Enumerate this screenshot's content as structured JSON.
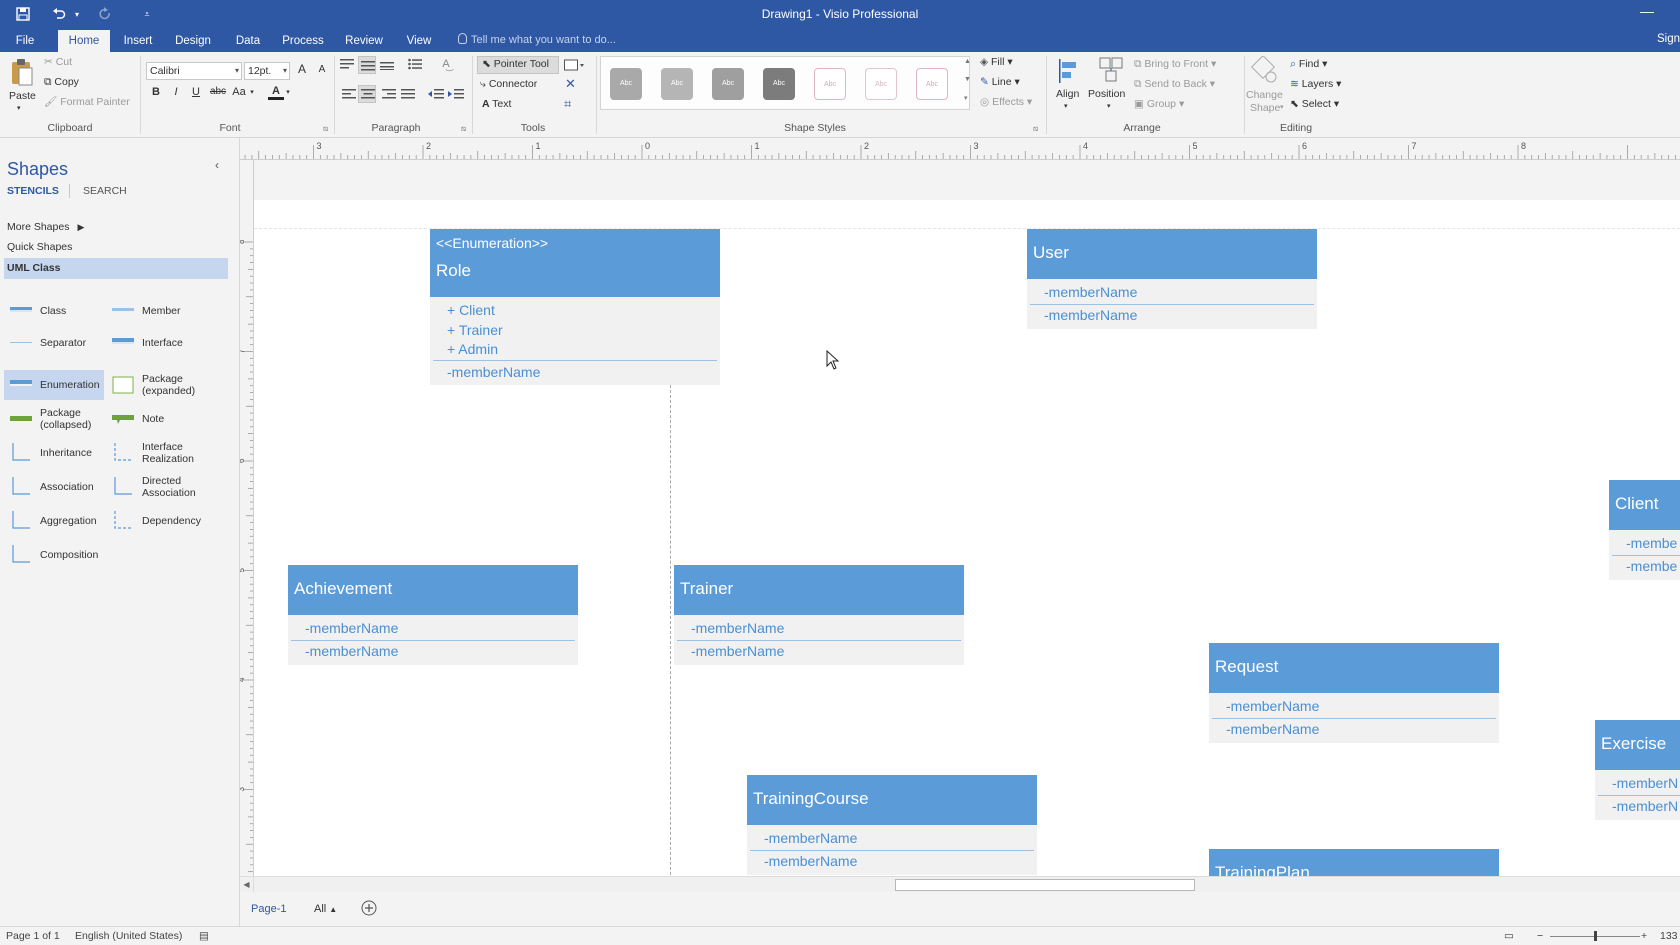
{
  "app": {
    "window_title": "Drawing1 - Visio Professional"
  },
  "quick_access": {
    "save_icon": "save-icon",
    "undo_icon": "undo-icon",
    "redo_icon": "redo-icon",
    "customize_icon": "customize-icon"
  },
  "tabs": [
    "File",
    "Home",
    "Insert",
    "Design",
    "Data",
    "Process",
    "Review",
    "View"
  ],
  "active_tab": "Home",
  "tell_me": "Tell me what you want to do...",
  "sign_in": "Sign",
  "ribbon": {
    "clipboard": {
      "paste": "Paste",
      "cut": "Cut",
      "copy": "Copy",
      "format_painter": "Format Painter",
      "label": "Clipboard"
    },
    "font": {
      "name": "Calibri",
      "size": "12pt.",
      "bold": "B",
      "italic": "I",
      "underline": "U",
      "strike": "abc",
      "case": "Aa",
      "color": "A",
      "grow": "A",
      "shrink": "A",
      "label": "Font"
    },
    "paragraph": {
      "label": "Paragraph"
    },
    "tools": {
      "pointer": "Pointer Tool",
      "connector": "Connector",
      "text": "Text",
      "label": "Tools"
    },
    "shape_styles": {
      "swatches": [
        "Abc",
        "Abc",
        "Abc",
        "Abc",
        "Abc",
        "Abc",
        "Abc"
      ],
      "fill": "Fill",
      "line": "Line",
      "effects": "Effects",
      "label": "Shape Styles"
    },
    "arrange": {
      "align": "Align",
      "position": "Position",
      "bring_front": "Bring to Front",
      "send_back": "Send to Back",
      "group": "Group",
      "label": "Arrange"
    },
    "editing": {
      "change_shape_1": "Change",
      "change_shape_2": "Shape",
      "find": "Find",
      "layers": "Layers",
      "select": "Select",
      "label": "Editing"
    }
  },
  "shapes_pane": {
    "title": "Shapes",
    "tab_stencils": "STENCILS",
    "tab_search": "SEARCH",
    "more_shapes": "More Shapes",
    "quick_shapes": "Quick Shapes",
    "current_stencil": "UML Class",
    "stencils": [
      {
        "label": "Class"
      },
      {
        "label": "Member"
      },
      {
        "label": "Separator"
      },
      {
        "label": "Interface"
      },
      {
        "label": "Enumeration"
      },
      {
        "label": "Package (expanded)"
      },
      {
        "label": "Package (collapsed)"
      },
      {
        "label": "Note"
      },
      {
        "label": "Inheritance"
      },
      {
        "label": "Interface Realization"
      },
      {
        "label": "Association"
      },
      {
        "label": "Directed Association"
      },
      {
        "label": "Aggregation"
      },
      {
        "label": "Dependency"
      },
      {
        "label": "Composition"
      }
    ]
  },
  "ruler": {
    "h_labels": [
      "3",
      "2",
      "1",
      "0",
      "1",
      "2",
      "3",
      "4",
      "5",
      "6",
      "7",
      "8"
    ],
    "v_labels": [
      "8",
      "7",
      "6",
      "5",
      "4",
      "3"
    ]
  },
  "diagram": {
    "role": {
      "stereotype": "<<Enumeration>>",
      "name": "Role",
      "literals": [
        "+ Client",
        "+ Trainer",
        "+ Admin"
      ],
      "member": "-memberName"
    },
    "user": {
      "name": "User",
      "members": [
        "-memberName",
        "-memberName"
      ]
    },
    "client": {
      "name": "Client",
      "members": [
        "-membe",
        "-membe"
      ]
    },
    "achievement": {
      "name": "Achievement",
      "members": [
        "-memberName",
        "-memberName"
      ]
    },
    "trainer": {
      "name": "Trainer",
      "members": [
        "-memberName",
        "-memberName"
      ]
    },
    "request": {
      "name": "Request",
      "members": [
        "-memberName",
        "-memberName"
      ]
    },
    "exercise": {
      "name": "Exercise",
      "members": [
        "-memberN",
        "-memberN"
      ]
    },
    "training_course": {
      "name": "TrainingCourse",
      "members": [
        "-memberName",
        "-memberName"
      ]
    },
    "training_plan": {
      "name": "TrainingPlan"
    }
  },
  "page_tabs": {
    "page1": "Page-1",
    "all": "All"
  },
  "status": {
    "page": "Page 1 of 1",
    "language": "English (United States)",
    "zoom": "133"
  },
  "colors": {
    "title_bar": "#2e57a4",
    "uml_header": "#5b9bd8",
    "uml_member_text": "#4a8fd4"
  }
}
